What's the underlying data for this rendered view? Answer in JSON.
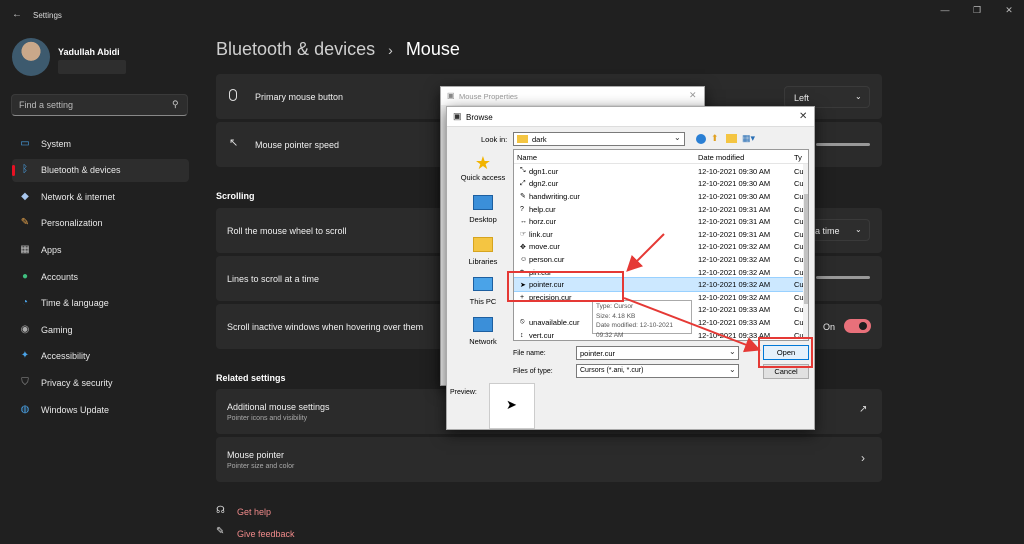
{
  "app": {
    "title": "Settings"
  },
  "user": {
    "name": "Yadullah Abidi"
  },
  "search": {
    "placeholder": "Find a setting"
  },
  "sidebar": {
    "items": [
      {
        "label": "System",
        "icon": "monitor-icon"
      },
      {
        "label": "Bluetooth & devices",
        "icon": "bluetooth-icon",
        "active": true
      },
      {
        "label": "Network & internet",
        "icon": "wifi-icon"
      },
      {
        "label": "Personalization",
        "icon": "brush-icon"
      },
      {
        "label": "Apps",
        "icon": "apps-icon"
      },
      {
        "label": "Accounts",
        "icon": "person-icon"
      },
      {
        "label": "Time & language",
        "icon": "globe-clock-icon"
      },
      {
        "label": "Gaming",
        "icon": "gamepad-icon"
      },
      {
        "label": "Accessibility",
        "icon": "accessibility-icon"
      },
      {
        "label": "Privacy & security",
        "icon": "shield-icon"
      },
      {
        "label": "Windows Update",
        "icon": "update-icon"
      }
    ]
  },
  "header": {
    "parent": "Bluetooth & devices",
    "separator": "›",
    "current": "Mouse"
  },
  "settings": {
    "primary_button": {
      "label": "Primary mouse button",
      "value": "Left"
    },
    "pointer_speed": {
      "label": "Mouse pointer speed"
    },
    "scrolling_title": "Scrolling",
    "roll_wheel": {
      "label": "Roll the mouse wheel to scroll",
      "value": "a time"
    },
    "lines_to_scroll": {
      "label": "Lines to scroll at a time"
    },
    "scroll_inactive": {
      "label": "Scroll inactive windows when hovering over them",
      "toggle_label": "On"
    },
    "related_title": "Related settings",
    "additional": {
      "label": "Additional mouse settings",
      "sub": "Pointer icons and visibility"
    },
    "mouse_pointer": {
      "label": "Mouse pointer",
      "sub": "Pointer size and color"
    },
    "get_help": "Get help",
    "give_feedback": "Give feedback"
  },
  "mouse_properties": {
    "title": "Mouse Properties"
  },
  "browse": {
    "title": "Browse",
    "look_in_label": "Look in:",
    "look_in_value": "dark",
    "places": [
      "Quick access",
      "Desktop",
      "Libraries",
      "This PC",
      "Network"
    ],
    "columns": {
      "name": "Name",
      "date": "Date modified",
      "type": "Ty"
    },
    "files": [
      {
        "name": "dgn1.cur",
        "date": "12-10-2021 09:30 AM",
        "type": "Cu"
      },
      {
        "name": "dgn2.cur",
        "date": "12-10-2021 09:30 AM",
        "type": "Cu"
      },
      {
        "name": "handwriting.cur",
        "date": "12-10-2021 09:30 AM",
        "type": "Cu"
      },
      {
        "name": "help.cur",
        "date": "12-10-2021 09:31 AM",
        "type": "Cu"
      },
      {
        "name": "horz.cur",
        "date": "12-10-2021 09:31 AM",
        "type": "Cu"
      },
      {
        "name": "link.cur",
        "date": "12-10-2021 09:31 AM",
        "type": "Cu"
      },
      {
        "name": "move.cur",
        "date": "12-10-2021 09:32 AM",
        "type": "Cu"
      },
      {
        "name": "person.cur",
        "date": "12-10-2021 09:32 AM",
        "type": "Cu"
      },
      {
        "name": "pin.cur",
        "date": "12-10-2021 09:32 AM",
        "type": "Cu"
      },
      {
        "name": "pointer.cur",
        "date": "12-10-2021 09:32 AM",
        "type": "Cu",
        "selected": true
      },
      {
        "name": "precision.cur",
        "date": "12-10-2021 09:32 AM",
        "type": "Cu"
      },
      {
        "name": "",
        "date": "12-10-2021 09:33 AM",
        "type": "Cu"
      },
      {
        "name": "unavailable.cur",
        "date": "12-10-2021 09:33 AM",
        "type": "Cu"
      },
      {
        "name": "vert.cur",
        "date": "12-10-2021 09:33 AM",
        "type": "Cu"
      }
    ],
    "tooltip": {
      "type": "Type: Cursor",
      "size": "Size: 4.18 KB",
      "date": "Date modified: 12-10-2021 09:32 AM"
    },
    "file_name_label": "File name:",
    "file_name_value": "pointer.cur",
    "file_type_label": "Files of type:",
    "file_type_value": "Cursors (*.ani, *.cur)",
    "open_label": "Open",
    "cancel_label": "Cancel",
    "preview_label": "Preview:"
  },
  "colors": {
    "accent": "#e53935",
    "toggle": "#e8707a",
    "bg": "#202020",
    "card": "#2b2b2b",
    "link": "#f08a8a"
  }
}
